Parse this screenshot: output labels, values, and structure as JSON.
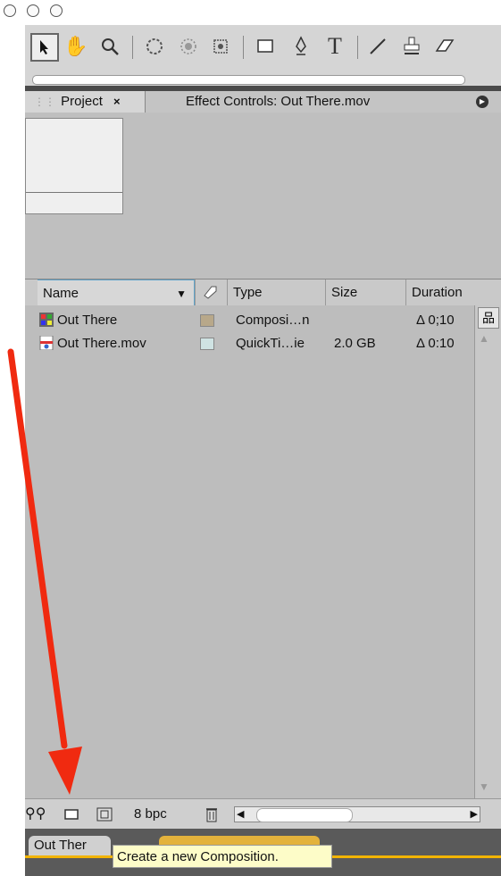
{
  "panel": {
    "tab_project": "Project",
    "tab_project_close": "×",
    "tab_effect": "Effect Controls: Out There.mov"
  },
  "columns": {
    "name": "Name",
    "type": "Type",
    "size": "Size",
    "duration": "Duration"
  },
  "items": [
    {
      "name": "Out There",
      "type": "Composi…n",
      "size": "",
      "duration": "Δ 0;10",
      "label_color": "#b8a88a",
      "icon": "composition-icon"
    },
    {
      "name": "Out There.mov",
      "type": "QuickTi…ie",
      "size": "2.0 GB",
      "duration": "Δ 0:10",
      "label_color": "#cfe3e3",
      "icon": "quicktime-file-icon"
    }
  ],
  "bottombar": {
    "bpc": "8 bpc"
  },
  "bottom_tab": "Out Ther",
  "tooltip": "Create a new Composition.",
  "colors": {
    "arrow": "#f02a10",
    "tooltip_bg": "#fdfcc8",
    "active_tab": "#f2b400"
  }
}
